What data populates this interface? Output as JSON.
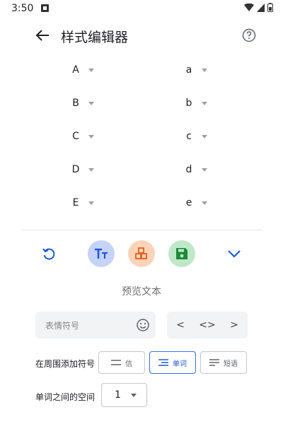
{
  "status": {
    "time": "3:50"
  },
  "appbar": {
    "title": "样式编辑器",
    "back_icon": "arrow-back-icon",
    "help_icon": "help-circle-icon"
  },
  "mappings": {
    "left": [
      "A",
      "B",
      "C",
      "D",
      "E"
    ],
    "right": [
      "a",
      "b",
      "c",
      "d",
      "e"
    ]
  },
  "toolbar": {
    "reset_icon": "undo-icon",
    "font_icon": "text-size-icon",
    "font_color": "#c5d3f8",
    "blocks_icon": "blocks-icon",
    "blocks_color": "#ffd3b8",
    "save_icon": "save-icon",
    "save_color": "#bfe8c8",
    "collapse_icon": "chevron-down-icon",
    "accent": "#1f58d6"
  },
  "preview_text": "预览文本",
  "emoji_field": {
    "placeholder": "表情符号"
  },
  "nav": {
    "prev": "<",
    "code": "<>",
    "next": ">"
  },
  "wrap": {
    "label": "在周围添加符号",
    "options": [
      "信",
      "单词",
      "短语"
    ],
    "selected": "单词"
  },
  "spacing": {
    "label": "单词之间的空间",
    "value": "1"
  }
}
